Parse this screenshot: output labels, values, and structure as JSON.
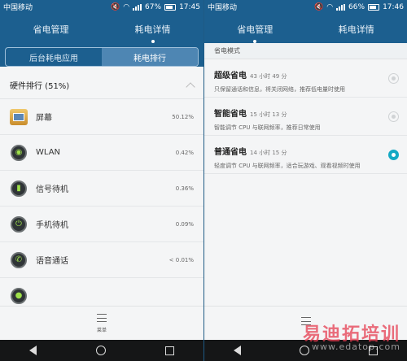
{
  "left": {
    "status": {
      "carrier": "中国移动",
      "battery": "67%",
      "time": "17:45"
    },
    "tabs": [
      "省电管理",
      "耗电详情"
    ],
    "active_tab": 1,
    "segments": [
      "后台耗电应用",
      "耗电排行"
    ],
    "section_title": "硬件排行 (51%)",
    "rows": [
      {
        "name": "屏幕",
        "pct": "50.12%",
        "icon": "screen-icon"
      },
      {
        "name": "WLAN",
        "pct": "0.42%",
        "icon": "wlan-icon"
      },
      {
        "name": "信号待机",
        "pct": "0.36%",
        "icon": "signal-icon"
      },
      {
        "name": "手机待机",
        "pct": "0.09%",
        "icon": "power-icon"
      },
      {
        "name": "语音通话",
        "pct": "< 0.01%",
        "icon": "phone-icon"
      }
    ],
    "menu_label": "菜单"
  },
  "right": {
    "status": {
      "carrier": "中国移动",
      "battery": "66%",
      "time": "17:46"
    },
    "tabs": [
      "省电管理",
      "耗电详情"
    ],
    "active_tab": 0,
    "mode_title": "省电模式",
    "modes": [
      {
        "title": "超级省电",
        "duration": "43 小时 49 分",
        "desc": "只保留通话和信息，将关闭网络，推荐低电量时使用",
        "selected": false
      },
      {
        "title": "智能省电",
        "duration": "15 小时 13 分",
        "desc": "智能调节 CPU 与联网频率，推荐日常使用",
        "selected": false
      },
      {
        "title": "普通省电",
        "duration": "14 小时 15 分",
        "desc": "轻度调节 CPU 与联网频率，适合玩游戏、观看视频时使用",
        "selected": true
      }
    ],
    "watermark": "易迪拓培训",
    "watermark_url": "www.edatop.com"
  },
  "colors": {
    "header": "#1c5f8f",
    "accent": "#14a9c4",
    "segment_active": "#4e86b3"
  }
}
